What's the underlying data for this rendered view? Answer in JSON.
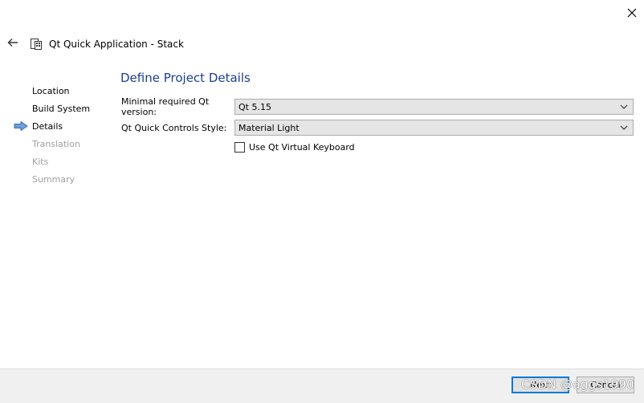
{
  "window": {
    "title": "Qt Quick Application - Stack"
  },
  "steps": [
    {
      "label": "Location",
      "state": "done"
    },
    {
      "label": "Build System",
      "state": "done"
    },
    {
      "label": "Details",
      "state": "current"
    },
    {
      "label": "Translation",
      "state": "disabled"
    },
    {
      "label": "Kits",
      "state": "disabled"
    },
    {
      "label": "Summary",
      "state": "disabled"
    }
  ],
  "page": {
    "heading": "Define Project Details",
    "qt_version_label": "Minimal required Qt version:",
    "qt_version_value": "Qt 5.15",
    "controls_style_label": "Qt Quick Controls Style:",
    "controls_style_value": "Material Light",
    "virtual_keyboard_label": "Use Qt Virtual Keyboard",
    "virtual_keyboard_checked": false
  },
  "footer": {
    "next_label": "Next",
    "cancel_label": "Cancel"
  },
  "watermark": "CSDN @aggs1990",
  "colors": {
    "heading": "#1d3f8f",
    "focus_border": "#0078d7",
    "step_arrow": "#4a7ebb",
    "disabled_text": "#a0a0a0"
  },
  "icons": [
    "close-icon",
    "back-arrow-icon",
    "app-wizard-icon",
    "current-step-arrow-icon",
    "chevron-down-icon"
  ]
}
